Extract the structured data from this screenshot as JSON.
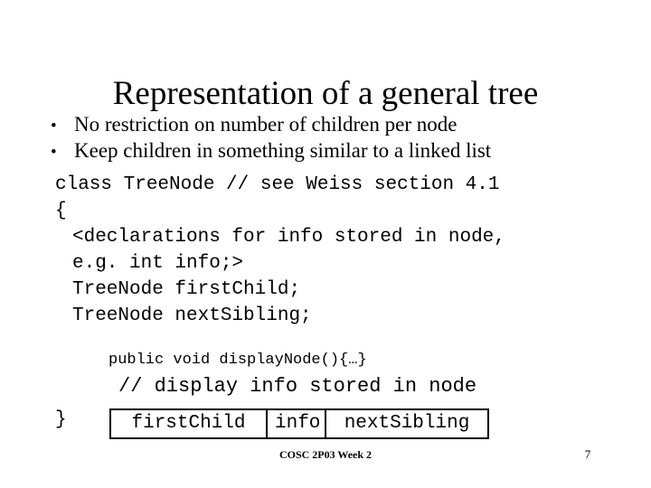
{
  "slide": {
    "title": "Representation of a general tree",
    "bullets": [
      {
        "marker": "•",
        "text": "No restriction on number of children per node"
      },
      {
        "marker": "•",
        "text": "Keep children in something similar to a linked list"
      }
    ],
    "code": {
      "lines": [
        {
          "text": "class TreeNode // see Weiss section 4.1",
          "indent": 0
        },
        {
          "text": "{",
          "indent": 0
        },
        {
          "text": "<declarations for info stored in node,",
          "indent": 1
        },
        {
          "text": "e.g. int info;>",
          "indent": 1
        },
        {
          "text": "TreeNode firstChild;",
          "indent": 1
        },
        {
          "text": "TreeNode nextSibling;",
          "indent": 1
        }
      ],
      "method_line": "public void displayNode(){…}",
      "comment_line": "// display info stored in node",
      "closing_brace": "}"
    },
    "node_diagram": {
      "cells": [
        {
          "label": "firstChild",
          "width": 171
        },
        {
          "label": "info",
          "width": 65
        },
        {
          "label": "nextSibling",
          "width": 180
        }
      ]
    },
    "footer": {
      "course": "COSC 2P03 Week 2",
      "page_number": "7"
    },
    "colors": {
      "background": "#ffffff",
      "text": "#000000",
      "box_border": "#000000"
    }
  }
}
